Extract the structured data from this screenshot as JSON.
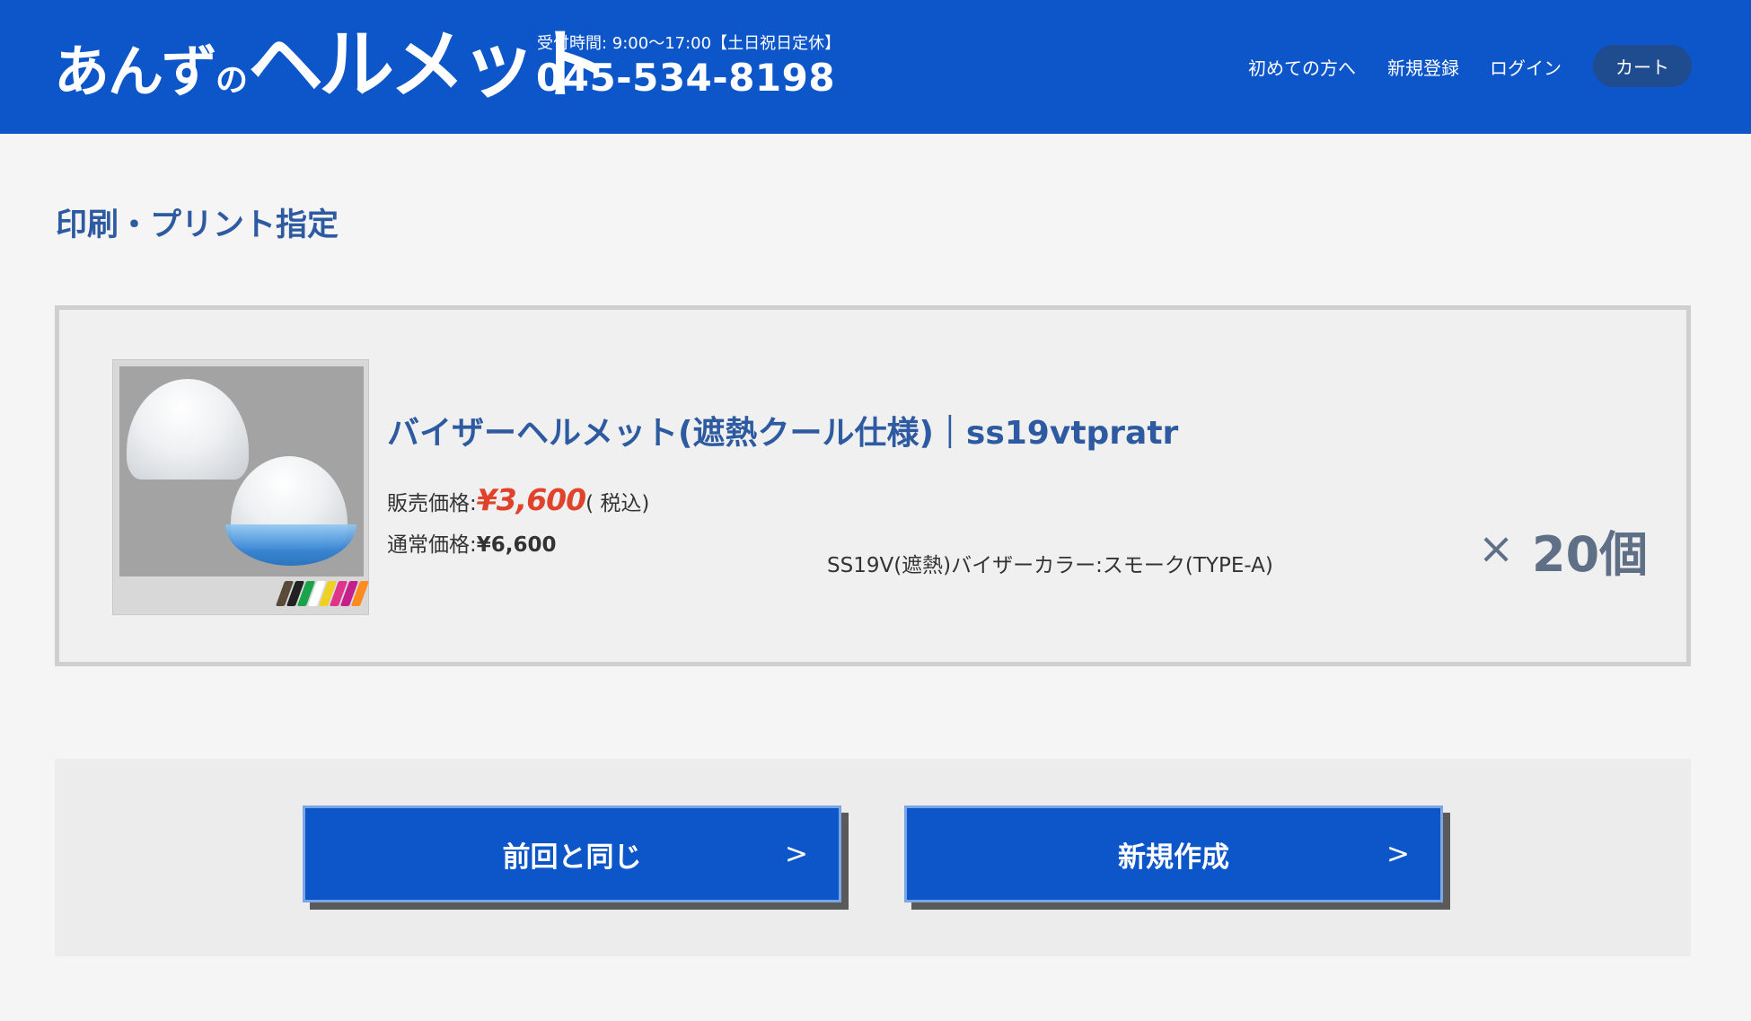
{
  "header": {
    "logo_part1": "あんず",
    "logo_part2": "の",
    "logo_part3": "ヘルメット",
    "hours": "受付時間: 9:00〜17:00【土日祝日定休】",
    "phone": "045-534-8198",
    "nav": {
      "first_time": "初めての方へ",
      "register": "新規登録",
      "login": "ログイン",
      "cart": "カート"
    },
    "bg_color": "#0c56c9"
  },
  "page_title": "印刷・プリント指定",
  "product": {
    "name": "バイザーヘルメット(遮熱クール仕様)｜ss19vtpratr",
    "sale_label": "販売価格:",
    "sale_price": "¥3,600",
    "tax_note": "( 税込)",
    "normal_label": "通常価格:",
    "normal_price": "¥6,600",
    "option": "SS19V(遮熱)バイザーカラー:スモーク(TYPE-A)",
    "times_symbol": "×",
    "quantity": "20個",
    "image_icon": "helmet-product-image",
    "swatch_colors": [
      "#5a4a3a",
      "#222222",
      "#1aa34a",
      "#ffffff",
      "#f0d020",
      "#e0338a",
      "#c41f8c",
      "#ff8a1f"
    ]
  },
  "actions": {
    "same_as_last": "前回と同じ",
    "new_create": "新規作成",
    "arrow": ">"
  },
  "colors": {
    "accent_blue": "#0c56c9",
    "title_blue": "#2d5aa0",
    "sale_red": "#e0432c"
  }
}
